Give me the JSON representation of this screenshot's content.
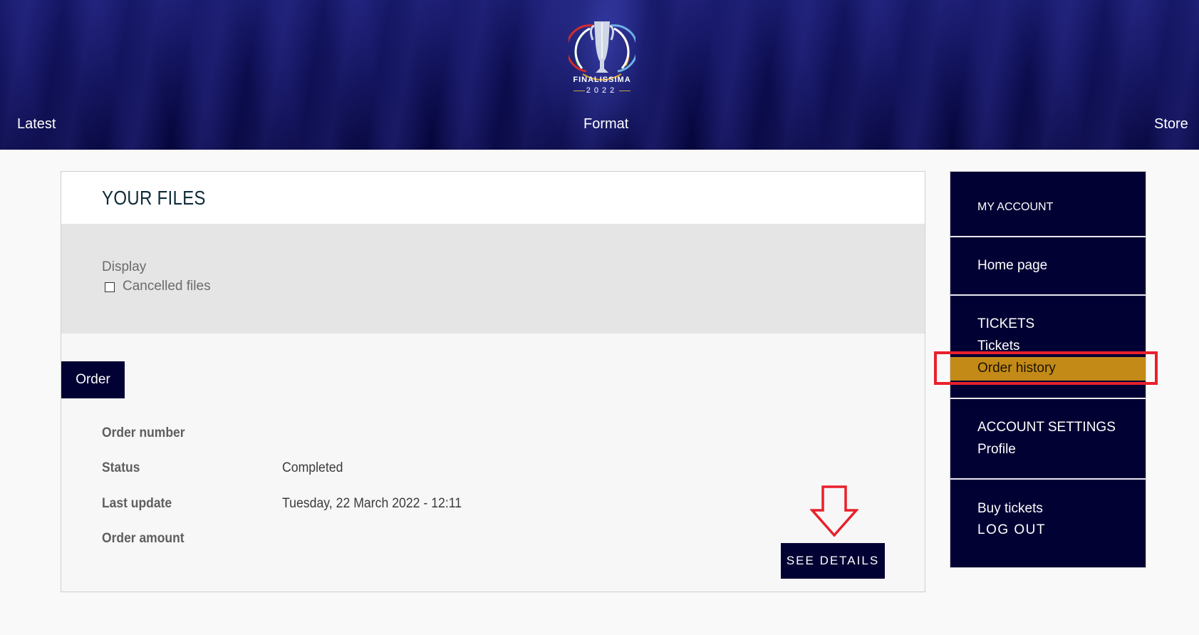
{
  "header": {
    "logo": {
      "icon": "trophy-icon",
      "brand": "FINALISSIMA",
      "year": "2022"
    },
    "nav": [
      {
        "label": "Latest"
      },
      {
        "label": "Format"
      },
      {
        "label": "Store"
      }
    ],
    "colors": {
      "background": "#0a0b4a"
    }
  },
  "files_card": {
    "title": "YOUR FILES",
    "filter": {
      "label": "Display",
      "checkbox_label": "Cancelled files",
      "checked": false
    },
    "tab_label": "Order",
    "rows": [
      {
        "label": "Order number",
        "value": ""
      },
      {
        "label": "Status",
        "value": "Completed"
      },
      {
        "label": "Last update",
        "value": "Tuesday, 22 March 2022 - 12:11"
      },
      {
        "label": "Order amount",
        "value": ""
      }
    ],
    "see_details_label": "SEE DETAILS"
  },
  "sidebar": {
    "header": "MY ACCOUNT",
    "home": "Home page",
    "tickets_section": "TICKETS",
    "tickets": "Tickets",
    "order_history": "Order history",
    "account_settings_section": "ACCOUNT SETTINGS",
    "profile": "Profile",
    "buy_tickets": "Buy tickets",
    "logout": "LOG OUT",
    "active_item": "Order history",
    "colors": {
      "background": "#020133",
      "active": "#c38a17"
    }
  },
  "annotations": {
    "highlight_color": "#e8212b",
    "arrow_icon": "down-arrow-icon"
  }
}
